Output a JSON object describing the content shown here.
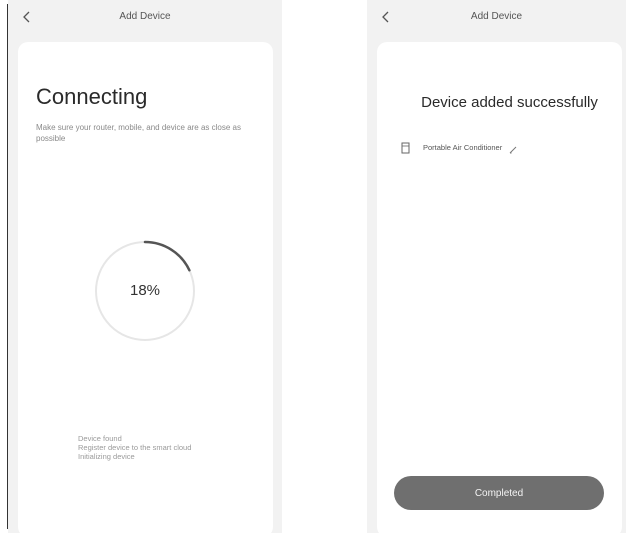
{
  "left_screen": {
    "header": {
      "title": "Add Device"
    },
    "title": "Connecting",
    "hint": "Make sure your router, mobile, and device are as close as possible",
    "progress": {
      "percent_label": "18%",
      "fraction": 0.18
    },
    "status": {
      "line1": "Device found",
      "line2": "Register device to the smart cloud",
      "line3": "Initializing device"
    }
  },
  "right_screen": {
    "header": {
      "title": "Add Device"
    },
    "title": "Device added successfully",
    "device": {
      "name": "Portable Air Conditioner"
    },
    "completed_button": {
      "label": "Completed"
    }
  },
  "icons": {
    "back": "chevron-left-icon",
    "device": "device-icon",
    "edit": "pencil-icon"
  },
  "colors": {
    "screen_bg": "#f2f2f2",
    "card_bg": "#ffffff",
    "ring_track": "#e6e6e6",
    "ring_progress": "#555555",
    "button_bg": "#6f6f6f"
  }
}
